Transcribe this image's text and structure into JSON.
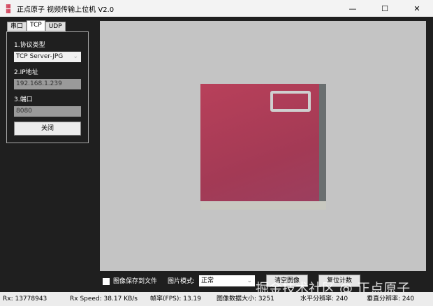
{
  "window": {
    "title": "正点原子 视频传输上位机 V2.0",
    "logo_text": "ATK",
    "minimize": "—",
    "maximize": "☐",
    "close": "✕"
  },
  "tabs": [
    "串口",
    "TCP",
    "UDP"
  ],
  "panel": {
    "protocol_label": "1.协议类型",
    "protocol_value": "TCP Server-JPG",
    "ip_label": "2.IP地址",
    "ip_value": "192.168.1.239",
    "port_label": "3.端口",
    "port_value": "8080",
    "close_button": "关闭"
  },
  "controls": {
    "save_checkbox": "图像保存到文件",
    "mode_label": "图片模式:",
    "mode_value": "正常",
    "clear_button": "清空图像",
    "reset_button": "复位计数"
  },
  "watermark": "掘金技术社区 @ 正点原子",
  "status": {
    "rx": "Rx:  13778943",
    "rx_speed": "Rx Speed:  38.17 KB/s",
    "fps": "帧率(FPS):  13.19",
    "size": "图像数据大小:  3251",
    "h_res": "水平分辨率:  240",
    "v_res": "垂直分辨率:  240"
  }
}
